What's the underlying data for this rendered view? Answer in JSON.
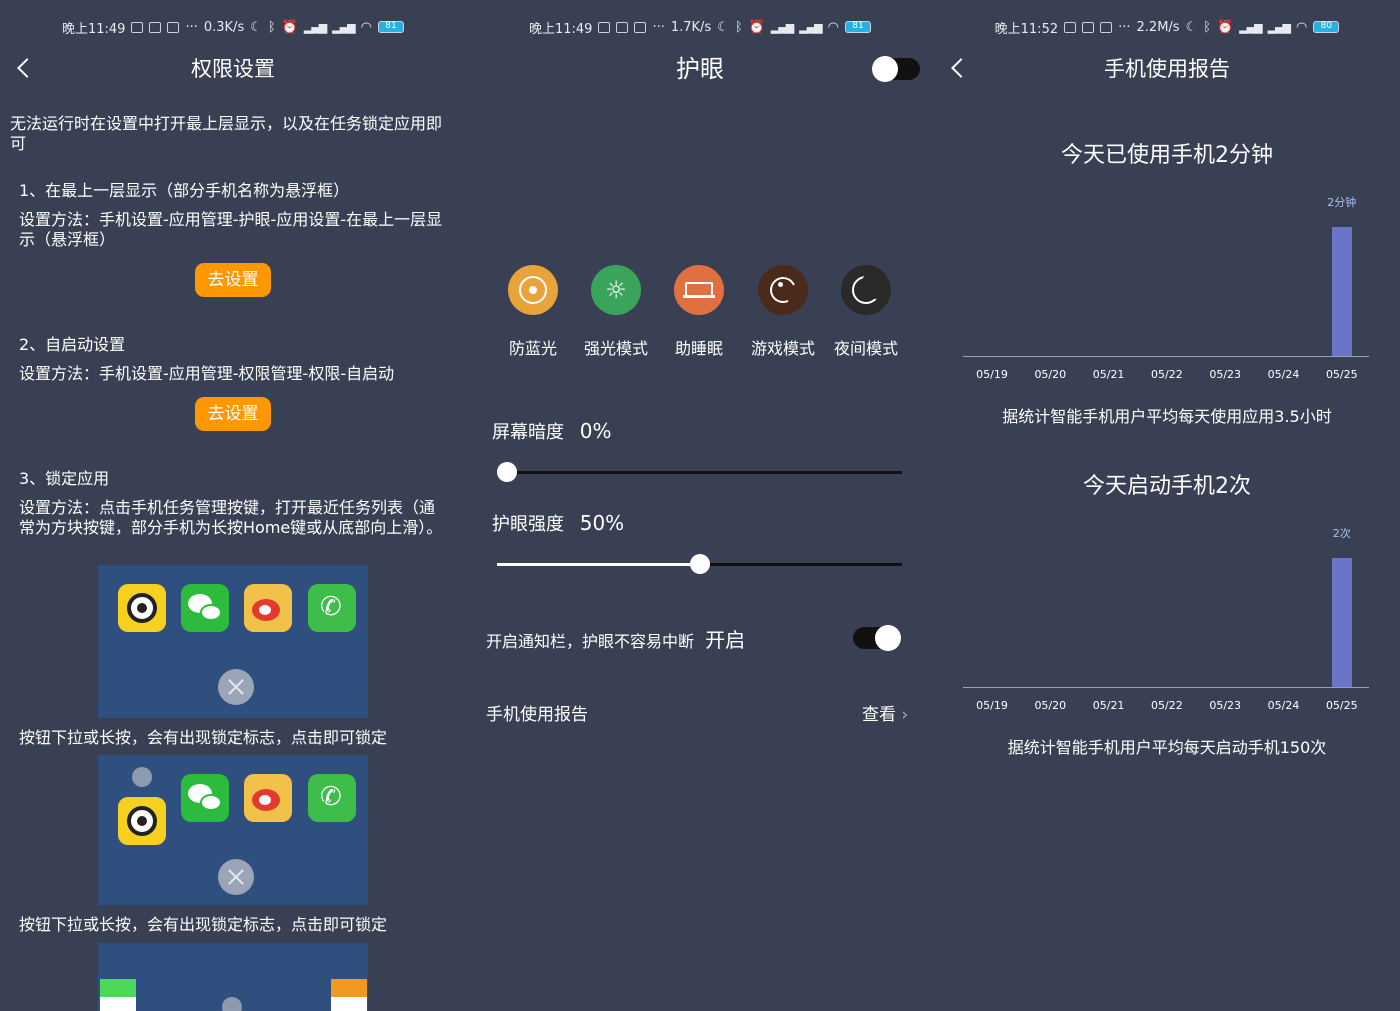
{
  "panel1": {
    "status": {
      "time": "晚上11:49",
      "dots": "···",
      "speed": "0.3K/s",
      "battery": "81"
    },
    "title": "权限设置",
    "intro": "无法运行时在设置中打开最上层显示，以及在任务锁定应用即可",
    "s1_head": "1、在最上一层显示（部分手机名称为悬浮框）",
    "s1_desc": "设置方法：手机设置-应用管理-护眼-应用设置-在最上一层显示（悬浮框）",
    "go_label": "去设置",
    "s2_head": "2、自启动设置",
    "s2_desc": "设置方法：手机设置-应用管理-权限管理-权限-自启动",
    "s3_head": "3、锁定应用",
    "s3_desc": "设置方法：点击手机任务管理按键，打开最近任务列表（通常为方块按键，部分手机为长按Home键或从底部向上滑）。",
    "caption1": "按钮下拉或长按，会有出现锁定标志，点击即可锁定",
    "caption2": "按钮下拉或长按，会有出现锁定标志，点击即可锁定"
  },
  "panel2": {
    "status": {
      "time": "晚上11:49",
      "dots": "···",
      "speed": "1.7K/s",
      "battery": "81"
    },
    "title": "护眼",
    "modes": [
      {
        "label": "防蓝光",
        "color": "#e8a33a"
      },
      {
        "label": "强光模式",
        "color": "#3aa55a"
      },
      {
        "label": "助睡眠",
        "color": "#e07040"
      },
      {
        "label": "游戏模式",
        "color": "#4a2a1a"
      },
      {
        "label": "夜间模式",
        "color": "#2a2a2a"
      }
    ],
    "dim_label": "屏幕暗度",
    "dim_value": "0%",
    "dim_level": 0,
    "strength_label": "护眼强度",
    "strength_value": "50%",
    "strength_level": 0.5,
    "notify_label": "开启通知栏，护眼不容易中断",
    "notify_state": "开启",
    "report_label": "手机使用报告",
    "report_action": "查看"
  },
  "panel3": {
    "status": {
      "time": "晚上11:52",
      "dots": "···",
      "speed": "2.2M/s",
      "battery": "80"
    },
    "title": "手机使用报告",
    "chart1_title": "今天已使用手机2分钟",
    "chart1_note": "据统计智能手机用户平均每天使用应用3.5小时",
    "chart2_title": "今天启动手机2次",
    "chart2_note": "据统计智能手机用户平均每天启动手机150次"
  },
  "chart_data": [
    {
      "type": "bar",
      "title": "今天已使用手机2分钟",
      "categories": [
        "05/19",
        "05/20",
        "05/21",
        "05/22",
        "05/23",
        "05/24",
        "05/25"
      ],
      "values": [
        0,
        0,
        0,
        0,
        0,
        0,
        2
      ],
      "data_labels": [
        "",
        "",
        "",
        "",
        "",
        "",
        "2分钟"
      ],
      "ylim": [
        0,
        2.3
      ]
    },
    {
      "type": "bar",
      "title": "今天启动手机2次",
      "categories": [
        "05/19",
        "05/20",
        "05/21",
        "05/22",
        "05/23",
        "05/24",
        "05/25"
      ],
      "values": [
        0,
        0,
        0,
        0,
        0,
        0,
        2
      ],
      "data_labels": [
        "",
        "",
        "",
        "",
        "",
        "",
        "2次"
      ],
      "ylim": [
        0,
        2.3
      ]
    }
  ]
}
